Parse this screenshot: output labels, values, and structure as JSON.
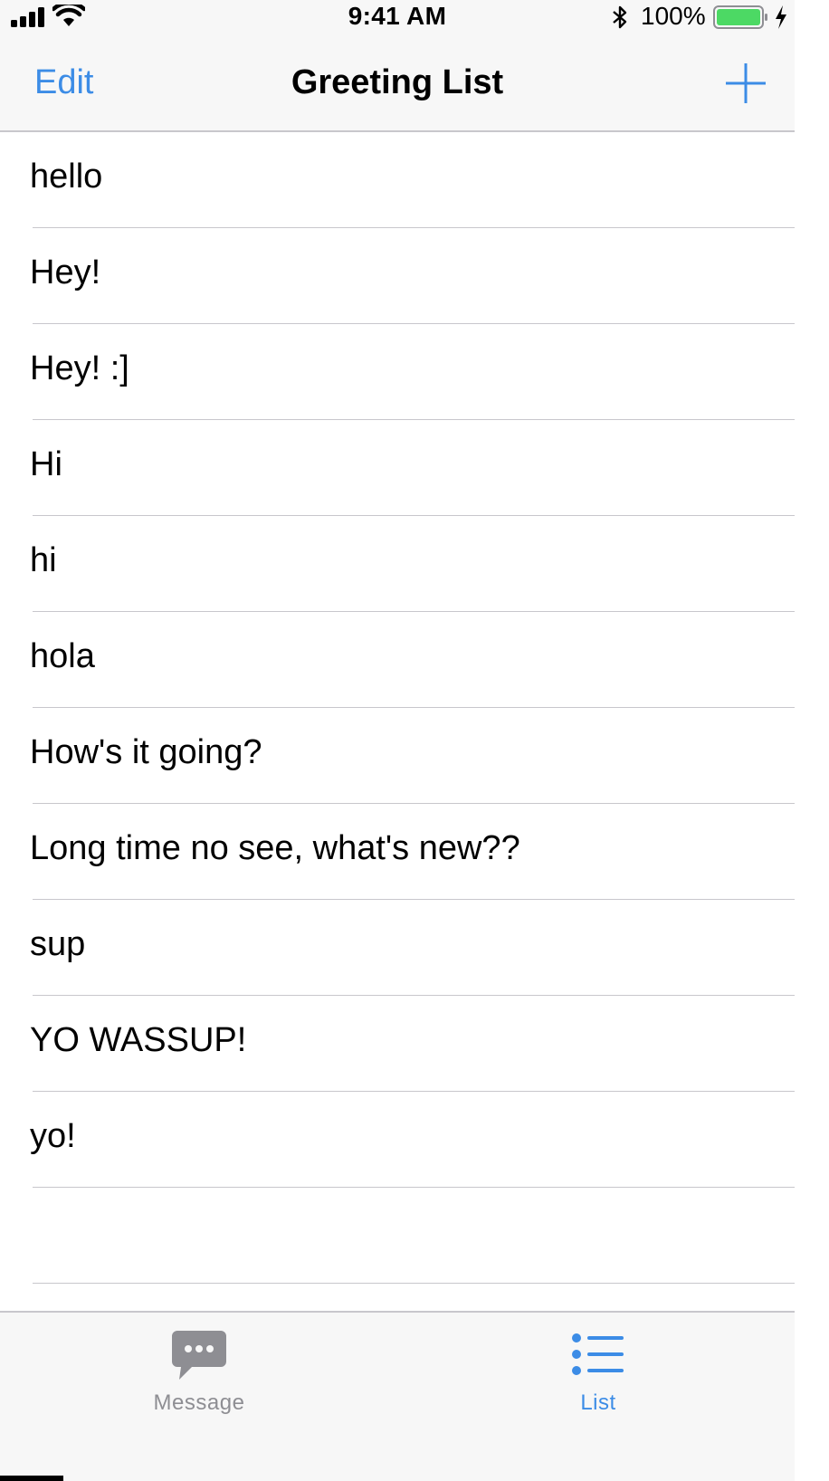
{
  "status_bar": {
    "time": "9:41 AM",
    "battery_percent": "100%",
    "battery_level": 1.0,
    "signal_icon": "cellular-signal-icon",
    "wifi_icon": "wifi-icon",
    "bluetooth_icon": "bluetooth-icon",
    "battery_icon": "battery-icon",
    "charging_icon": "charging-bolt-icon"
  },
  "nav": {
    "edit_label": "Edit",
    "title": "Greeting List",
    "add_icon": "plus-icon"
  },
  "list": {
    "items": [
      "hello",
      "Hey!",
      "Hey! :]",
      "Hi",
      "hi",
      "hola",
      "How's it going?",
      "Long time no see, what's new??",
      "sup",
      "YO WASSUP!",
      "yo!",
      ""
    ]
  },
  "tab_bar": {
    "tabs": [
      {
        "label": "Message",
        "icon": "message-bubble-icon",
        "selected": false
      },
      {
        "label": "List",
        "icon": "list-icon",
        "selected": true
      }
    ]
  },
  "colors": {
    "accent": "#3c8ce6",
    "inactive": "#8e8e93",
    "separator": "#c8c7cc",
    "bar_background": "#f7f7f7",
    "battery_fill": "#4cd964"
  }
}
